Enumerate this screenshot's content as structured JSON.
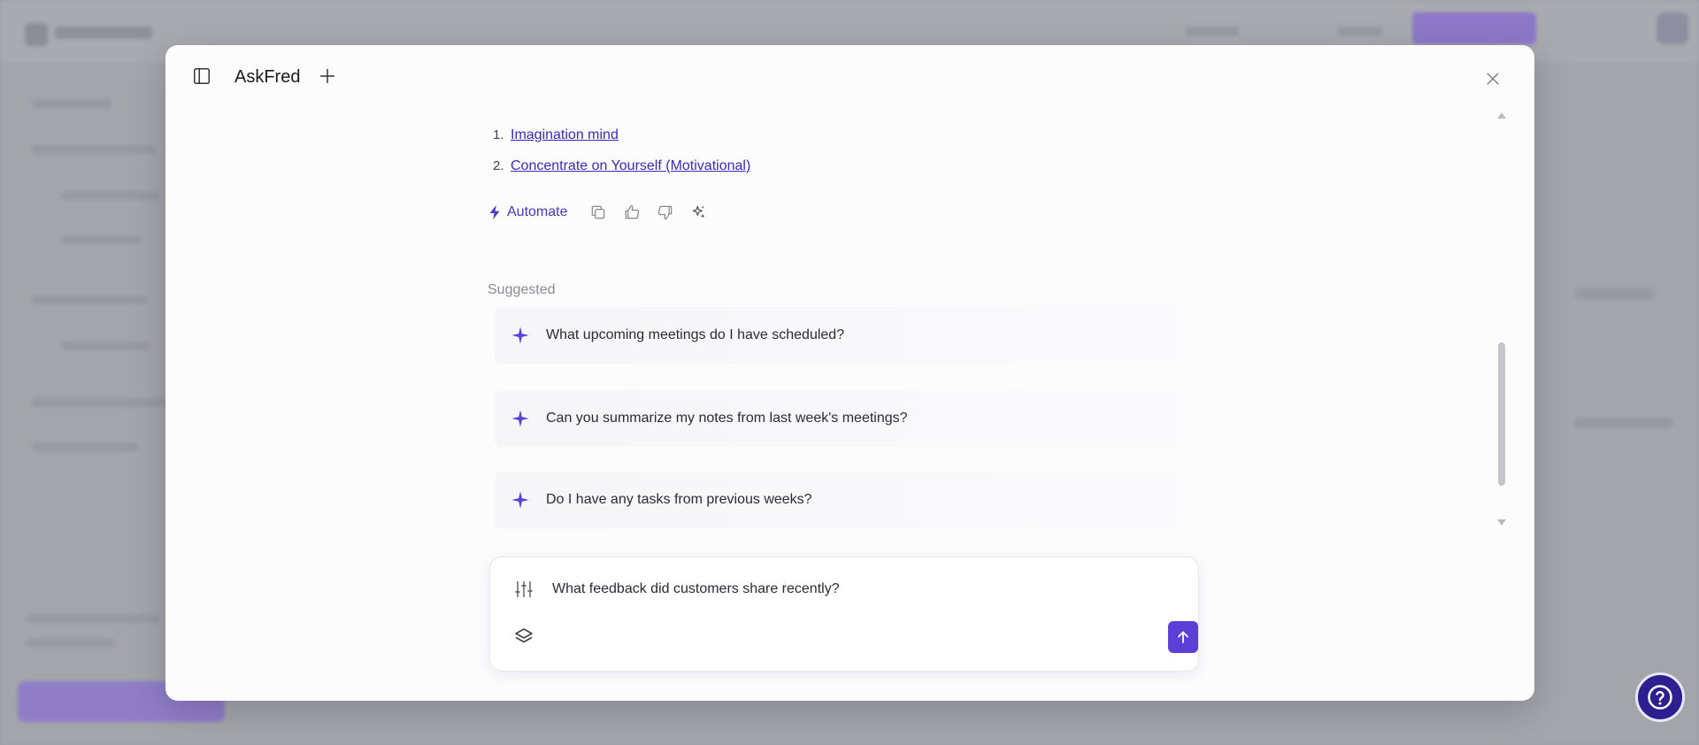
{
  "modal": {
    "title": "AskFred"
  },
  "links": [
    {
      "number": "1.",
      "label": "Imagination mind"
    },
    {
      "number": "2.",
      "label": "Concentrate on Yourself (Motivational)"
    }
  ],
  "actions": {
    "automate_label": "Automate",
    "icons": [
      "copy-icon",
      "thumbs-up-icon",
      "thumbs-down-icon",
      "sparkle-icon"
    ]
  },
  "suggested": {
    "label": "Suggested",
    "items": [
      "What upcoming meetings do I have scheduled?",
      "Can you summarize my notes from last week's meetings?",
      "Do I have any tasks from previous weeks?"
    ]
  },
  "composer": {
    "placeholder": "What feedback did customers share recently?"
  },
  "colors": {
    "accent": "#5b3fd6",
    "link": "#3a2bbd",
    "help_button": "#2d1f8f"
  }
}
